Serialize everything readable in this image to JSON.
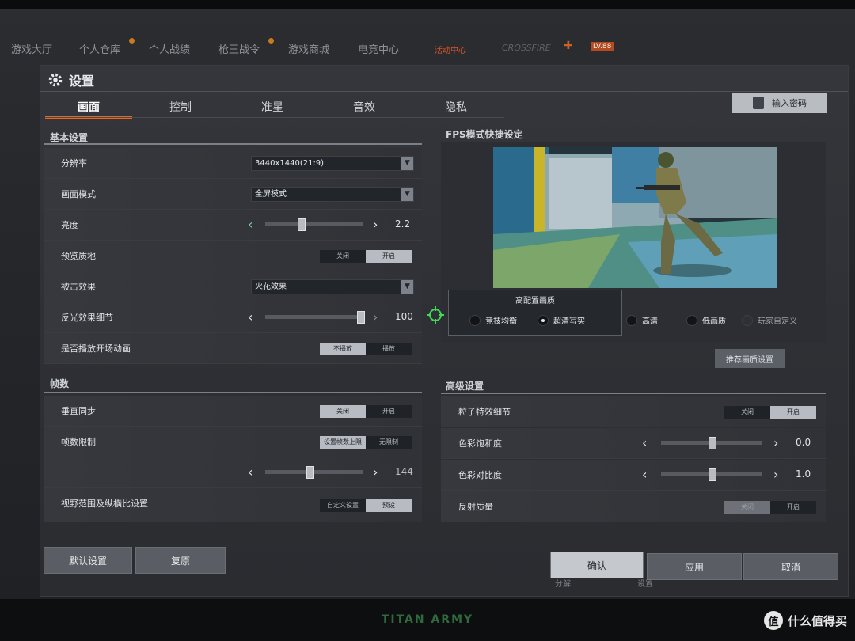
{
  "top_nav": {
    "items": [
      "游戏大厅",
      "个人仓库",
      "个人战绩",
      "枪王战令",
      "游戏商城",
      "电竞中心"
    ],
    "activity": "活动中心",
    "brand_tag": "CROSSFIRE",
    "badge": "LV.88"
  },
  "settings": {
    "title": "设置",
    "tabs": [
      "画面",
      "控制",
      "准星",
      "音效",
      "隐私"
    ],
    "password_button": "输入密码",
    "basic_section": "基本设置",
    "resolution": {
      "label": "分辨率",
      "value": "3440x1440(21:9)"
    },
    "screen_mode": {
      "label": "画面模式",
      "value": "全屏模式"
    },
    "brightness": {
      "label": "亮度",
      "value": "2.2",
      "level": 0.35
    },
    "preview_texture": {
      "label": "预览质地",
      "off": "关闭",
      "on": "开启"
    },
    "hit_effect": {
      "label": "被击效果",
      "value": "火花效果"
    },
    "reflection_detail": {
      "label": "反光效果细节",
      "value": "100",
      "level": 1.0
    },
    "play_intro": {
      "label": "是否播放开场动画",
      "no": "不播放",
      "yes": "播放"
    },
    "fps_section": "帧数",
    "vsync": {
      "label": "垂直同步",
      "off": "关闭",
      "on": "开启"
    },
    "fps_limit": {
      "label": "帧数限制",
      "set": "设置帧数上限",
      "unlimited": "无限制"
    },
    "fps_value": {
      "value": "144",
      "level": 0.45
    },
    "fov": {
      "label": "视野范围及纵横比设置",
      "custom": "自定义设置",
      "preset": "预设"
    },
    "fps_quick_section": "FPS模式快捷设定",
    "quality": {
      "caption": "高配置画质",
      "options": [
        "竞技均衡",
        "超清写实",
        "高清",
        "低画质",
        "玩家自定义"
      ],
      "selected": "超清写实"
    },
    "recommend_button": "推荐画质设置",
    "advanced_section": "高级设置",
    "particle_detail": {
      "label": "粒子特效细节",
      "off": "关闭",
      "on": "开启"
    },
    "saturation": {
      "label": "色彩饱和度",
      "value": "0.0",
      "level": 0.5
    },
    "contrast": {
      "label": "色彩对比度",
      "value": "1.0",
      "level": 0.5
    },
    "reflection_quality": {
      "label": "反射质量",
      "off": "关闭",
      "on": "开启"
    },
    "buttons": {
      "default": "默认设置",
      "restore": "复原",
      "confirm": "确认",
      "apply": "应用",
      "cancel": "取消"
    }
  },
  "under_panel": {
    "share": "分解",
    "settings": "设置"
  },
  "bezel": {
    "brand": "TITAN ARMY"
  },
  "watermark": {
    "icon_text": "值",
    "text": "什么值得买"
  },
  "colors": {
    "accent": "#e06a22",
    "crosshair": "#3fdc55"
  }
}
